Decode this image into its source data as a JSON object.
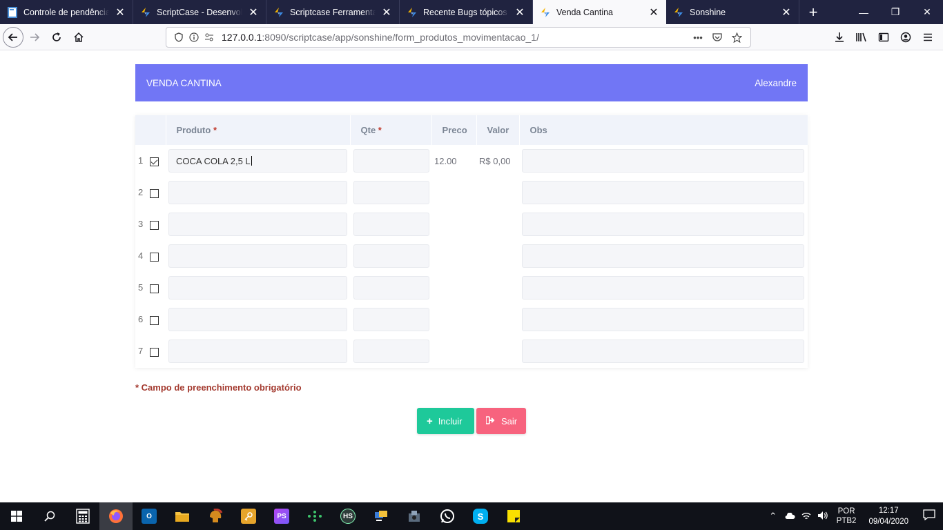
{
  "browser": {
    "tabs": [
      {
        "title": "Controle de pendências | S",
        "favicon": "page-icon",
        "active": false
      },
      {
        "title": "ScriptCase - Desenvolvime",
        "favicon": "scriptcase-icon",
        "active": false
      },
      {
        "title": "Scriptcase Ferramenta de",
        "favicon": "scriptcase-icon",
        "active": false
      },
      {
        "title": "Recente Bugs tópicos - Sc",
        "favicon": "scriptcase-icon",
        "active": false
      },
      {
        "title": "Venda Cantina",
        "favicon": "scriptcase-icon",
        "active": true
      },
      {
        "title": "Sonshine",
        "favicon": "scriptcase-icon",
        "active": false
      }
    ],
    "url_host": "127.0.0.1",
    "url_rest": ":8090/scriptcase/app/sonshine/form_produtos_movimentacao_1/"
  },
  "app": {
    "header_title": "VENDA CANTINA",
    "user_name": "Alexandre",
    "columns": {
      "produto": "Produto",
      "qte": "Qte",
      "preco": "Preco",
      "valor": "Valor",
      "obs": "Obs",
      "required_mark": "*"
    },
    "rows": [
      {
        "num": "1",
        "checked": true,
        "produto": "COCA COLA 2,5 L",
        "qte": "",
        "preco": "12.00",
        "valor": "R$ 0,00",
        "obs": ""
      },
      {
        "num": "2",
        "checked": false,
        "produto": "",
        "qte": "",
        "preco": "",
        "valor": "",
        "obs": ""
      },
      {
        "num": "3",
        "checked": false,
        "produto": "",
        "qte": "",
        "preco": "",
        "valor": "",
        "obs": ""
      },
      {
        "num": "4",
        "checked": false,
        "produto": "",
        "qte": "",
        "preco": "",
        "valor": "",
        "obs": ""
      },
      {
        "num": "5",
        "checked": false,
        "produto": "",
        "qte": "",
        "preco": "",
        "valor": "",
        "obs": ""
      },
      {
        "num": "6",
        "checked": false,
        "produto": "",
        "qte": "",
        "preco": "",
        "valor": "",
        "obs": ""
      },
      {
        "num": "7",
        "checked": false,
        "produto": "",
        "qte": "",
        "preco": "",
        "valor": "",
        "obs": ""
      }
    ],
    "required_note": "* Campo de preenchimento obrigatório",
    "buttons": {
      "incluir": "Incluir",
      "sair": "Sair"
    },
    "colors": {
      "header": "#7176f5",
      "incluir": "#1ec99a",
      "sair": "#f7637e",
      "required": "#a3392e"
    }
  },
  "taskbar": {
    "language": "POR",
    "layout": "PTB2",
    "time": "12:17",
    "date": "09/04/2020",
    "apps": [
      {
        "name": "calculator-icon",
        "label": ""
      },
      {
        "name": "firefox-icon",
        "label": ""
      },
      {
        "name": "outlook-icon",
        "label": ""
      },
      {
        "name": "file-explorer-icon",
        "label": ""
      },
      {
        "name": "spartan-helmet-icon",
        "label": ""
      },
      {
        "name": "key-icon",
        "label": ""
      },
      {
        "name": "phpstorm-icon",
        "label": "PS"
      },
      {
        "name": "network-icon",
        "label": ""
      },
      {
        "name": "heidisql-icon",
        "label": "HS"
      },
      {
        "name": "remote-desktop-icon",
        "label": ""
      },
      {
        "name": "tool-icon",
        "label": ""
      },
      {
        "name": "whatsapp-icon",
        "label": ""
      },
      {
        "name": "skype-icon",
        "label": "S"
      },
      {
        "name": "sticky-notes-icon",
        "label": ""
      }
    ]
  }
}
